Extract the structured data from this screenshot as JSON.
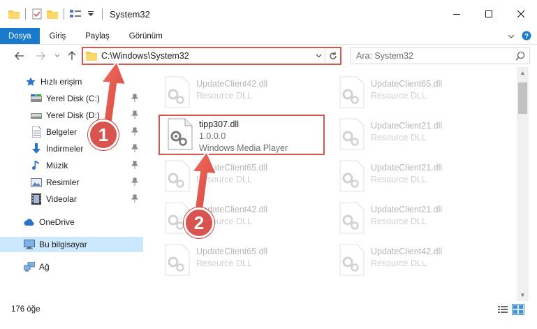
{
  "window": {
    "title": "System32"
  },
  "ribbon": {
    "tabs": [
      "Dosya",
      "Giriş",
      "Paylaş",
      "Görünüm"
    ]
  },
  "address": {
    "path": "C:\\Windows\\System32",
    "search_placeholder": "Ara: System32"
  },
  "nav": {
    "items": [
      {
        "label": "Hızlı erişim",
        "icon": "star-icon"
      },
      {
        "label": "Yerel Disk (C:)",
        "icon": "drive-icon"
      },
      {
        "label": "Yerel Disk (D:)",
        "icon": "drive-icon"
      },
      {
        "label": "Belgeler",
        "icon": "documents-icon"
      },
      {
        "label": "İndirmeler",
        "icon": "download-icon"
      },
      {
        "label": "Müzik",
        "icon": "music-icon"
      },
      {
        "label": "Resimler",
        "icon": "pictures-icon"
      },
      {
        "label": "Videolar",
        "icon": "videos-icon"
      },
      {
        "label": "OneDrive",
        "icon": "cloud-icon"
      },
      {
        "label": "Bu bilgisayar",
        "icon": "computer-icon"
      },
      {
        "label": "Ağ",
        "icon": "network-icon"
      }
    ]
  },
  "files": {
    "highlighted": {
      "name": "tipp307.dll",
      "version": "1.0.0.0",
      "type": "Windows Media Player"
    },
    "background": [
      {
        "name": "UpdateClient42.dll",
        "type": "Resource DLL"
      },
      {
        "name": "UpdateClient65.dll",
        "type": "Resource DLL"
      },
      {
        "name": "UpdateClient21.dll",
        "type": "Resource DLL"
      },
      {
        "name": "UpdateClient65.dll",
        "type": "Resource DLL"
      },
      {
        "name": "UpdateClient21.dll",
        "type": "Resource DLL"
      },
      {
        "name": "UpdateClient42.dll",
        "type": "Resource DLL"
      },
      {
        "name": "UpdateClient21.dll",
        "type": "Resource DLL"
      },
      {
        "name": "UpdateClient65.dll",
        "type": "Resource DLL"
      },
      {
        "name": "UpdateClient42.dll",
        "type": "Resource DLL"
      }
    ]
  },
  "status": {
    "count": "176 öğe"
  },
  "annotations": {
    "step1": "1",
    "step2": "2",
    "color": "#d9534f"
  }
}
